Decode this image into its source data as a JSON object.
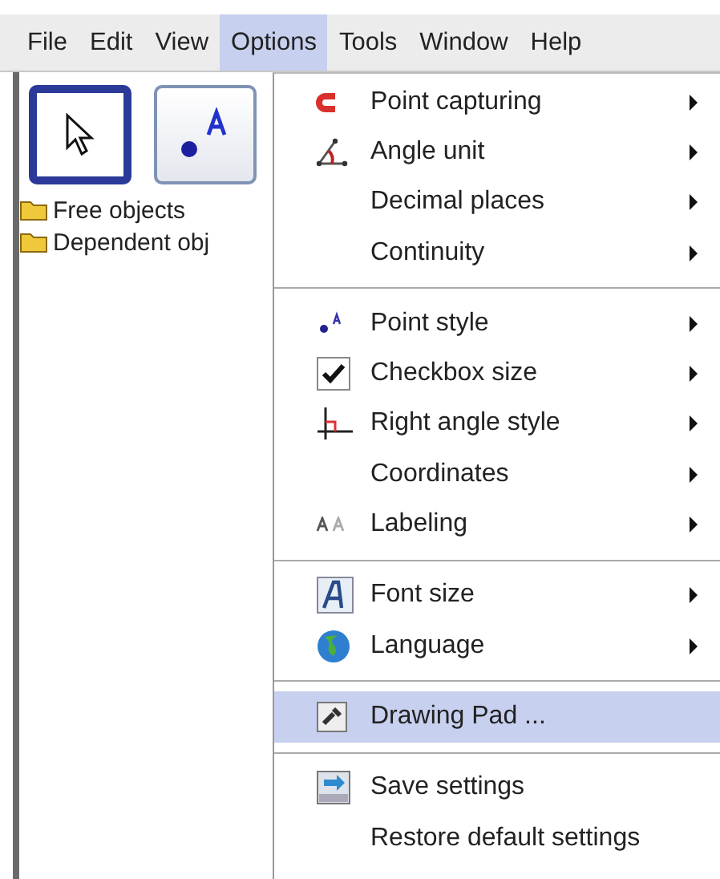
{
  "menubar": [
    {
      "label": "File",
      "selected": false
    },
    {
      "label": "Edit",
      "selected": false
    },
    {
      "label": "View",
      "selected": false
    },
    {
      "label": "Options",
      "selected": true
    },
    {
      "label": "Tools",
      "selected": false
    },
    {
      "label": "Window",
      "selected": false
    },
    {
      "label": "Help",
      "selected": false
    }
  ],
  "toolbar": [
    {
      "selected": true
    },
    {
      "selected": false
    }
  ],
  "tree": [
    "Free objects",
    "Dependent obj"
  ],
  "menu": [
    {
      "kind": "item",
      "label": "Point capturing",
      "submenu": true,
      "selected": false
    },
    {
      "kind": "item",
      "label": "Angle unit",
      "submenu": true,
      "selected": false
    },
    {
      "kind": "item",
      "label": "Decimal places",
      "submenu": true,
      "selected": false
    },
    {
      "kind": "item",
      "label": "Continuity",
      "submenu": true,
      "selected": false
    },
    {
      "kind": "separator"
    },
    {
      "kind": "item",
      "label": "Point style",
      "submenu": true,
      "selected": false
    },
    {
      "kind": "item",
      "label": "Checkbox size",
      "submenu": true,
      "selected": false
    },
    {
      "kind": "item",
      "label": "Right angle style",
      "submenu": true,
      "selected": false
    },
    {
      "kind": "item",
      "label": "Coordinates",
      "submenu": true,
      "selected": false
    },
    {
      "kind": "item",
      "label": "Labeling",
      "submenu": true,
      "selected": false
    },
    {
      "kind": "separator"
    },
    {
      "kind": "item",
      "label": "Font size",
      "submenu": true,
      "selected": false
    },
    {
      "kind": "item",
      "label": "Language",
      "submenu": true,
      "selected": false
    },
    {
      "kind": "separator"
    },
    {
      "kind": "item",
      "label": "Drawing Pad ...",
      "submenu": false,
      "selected": true
    },
    {
      "kind": "separator"
    },
    {
      "kind": "item",
      "label": "Save settings",
      "submenu": false,
      "selected": false
    },
    {
      "kind": "item",
      "label": "Restore default settings",
      "submenu": false,
      "selected": false
    }
  ]
}
